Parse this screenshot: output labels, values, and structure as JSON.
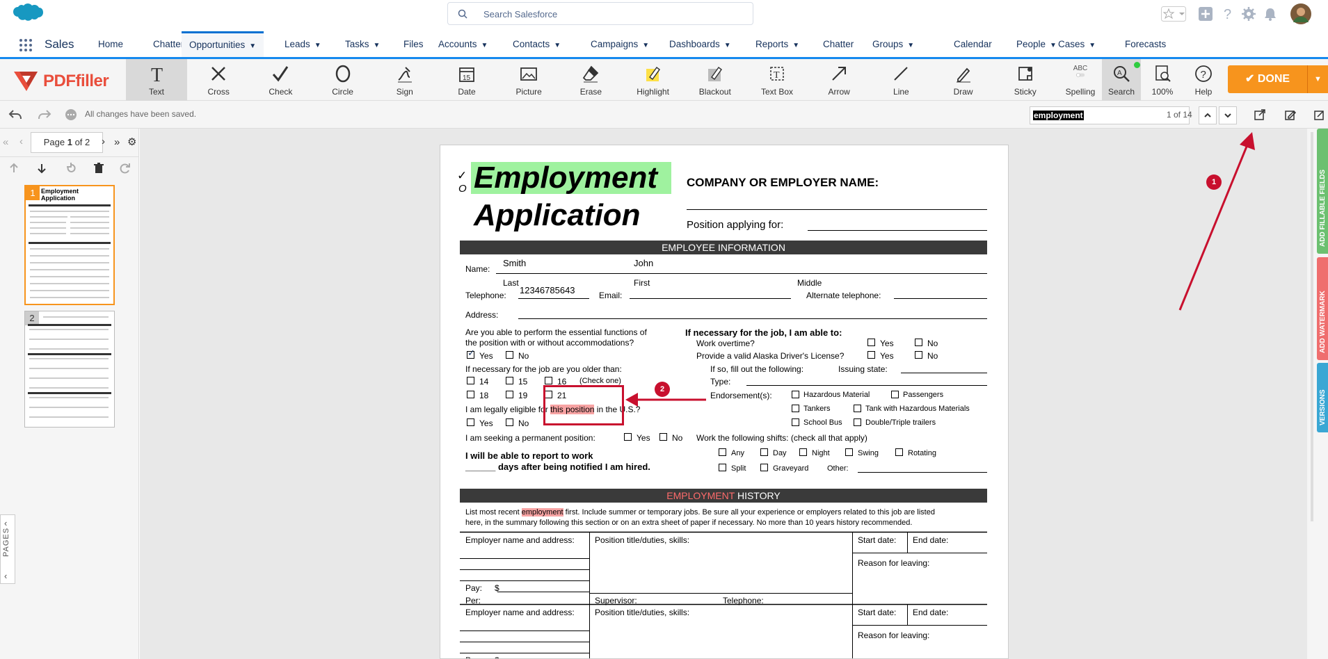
{
  "header": {
    "search_placeholder": "Search Salesforce",
    "app_name": "Sales"
  },
  "nav": {
    "items": [
      {
        "label": "Home",
        "chev": false
      },
      {
        "label": "Chatter",
        "chev": false
      },
      {
        "label": "Opportunities",
        "chev": true,
        "active": true
      },
      {
        "label": "Leads",
        "chev": true
      },
      {
        "label": "Tasks",
        "chev": true
      },
      {
        "label": "Files",
        "chev": false
      },
      {
        "label": "Accounts",
        "chev": true
      },
      {
        "label": "Contacts",
        "chev": true
      },
      {
        "label": "Campaigns",
        "chev": true
      },
      {
        "label": "Dashboards",
        "chev": true
      },
      {
        "label": "Reports",
        "chev": true
      },
      {
        "label": "Chatter",
        "chev": false
      },
      {
        "label": "Groups",
        "chev": true
      },
      {
        "label": "Calendar",
        "chev": false
      },
      {
        "label": "People",
        "chev": true
      },
      {
        "label": "Cases",
        "chev": true
      },
      {
        "label": "Forecasts",
        "chev": false
      }
    ]
  },
  "toolbar": {
    "logo": "PDFfiller",
    "tools": [
      "Text",
      "Cross",
      "Check",
      "Circle",
      "Sign",
      "Date",
      "Picture",
      "Erase",
      "Highlight",
      "Blackout",
      "Text Box",
      "Arrow",
      "Line",
      "Draw",
      "Sticky"
    ],
    "spelling": "Spelling",
    "spelling_top": "ABC",
    "search": "Search",
    "zoom": "100%",
    "help": "Help",
    "done": "DONE"
  },
  "subbar": {
    "saved": "All changes have been saved.",
    "find_value": "employment",
    "find_count": "1 of 14"
  },
  "pager": {
    "label_prefix": "Page ",
    "current": "1",
    "of": " of 2"
  },
  "thumbs": {
    "p1": "1",
    "p2": "2",
    "p1_title1": "Employment",
    "p1_title2": "Application"
  },
  "pages_tab": "PAGES",
  "side_tabs": {
    "fields": "ADD FILLABLE FIELDS",
    "watermark": "ADD WATERMARK",
    "versions": "VERSIONS"
  },
  "callouts": {
    "one": "1",
    "two": "2"
  },
  "form": {
    "title1": "Employment",
    "title2": "Application",
    "company": "COMPANY OR EMPLOYER NAME:",
    "position_for": "Position applying for:",
    "sec_employee": "EMPLOYEE INFORMATION",
    "name_lbl": "Name:",
    "last_val": "Smith",
    "first_val": "John",
    "last": "Last",
    "first": "First",
    "middle": "Middle",
    "telephone": "Telephone:",
    "tel_val": "12346785643",
    "email": "Email:",
    "alt_tel": "Alternate telephone:",
    "address": "Address:",
    "q_essential1": "Are you able to perform the essential functions of",
    "q_essential2": "the position with or without accommodations?",
    "yes": "Yes",
    "no": "No",
    "q_older": "If necessary for the job are you older than:",
    "a14": "14",
    "a15": "15",
    "a16": "16",
    "check_one": "(Check one)",
    "a18": "18",
    "a19": "19",
    "a21": "21",
    "q_eligible_a": "I am legally eligible for ",
    "q_eligible_hl": "this position",
    "q_eligible_b": " in the U.S.?",
    "q_permanent": "I am seeking a permanent position:",
    "report1": "I will be able to report to work",
    "report2": "______ days after being notified I am hired.",
    "able_to": "If necessary for the job, I am able to:",
    "overtime": "Work overtime?",
    "license": "Provide a valid Alaska Driver's License?",
    "fill_out": "If so, fill out the following:",
    "issuing": "Issuing state:",
    "type": "Type:",
    "endorse": "Endorsement(s):",
    "hazmat": "Hazardous Material",
    "passengers": "Passengers",
    "tankers": "Tankers",
    "tank_haz": "Tank with Hazardous Materials",
    "school": "School Bus",
    "double": "Double/Triple trailers",
    "shifts": "Work the following shifts: (check all that apply)",
    "any": "Any",
    "day": "Day",
    "night": "Night",
    "swing": "Swing",
    "rotating": "Rotating",
    "split": "Split",
    "graveyard": "Graveyard",
    "other": "Other:",
    "sec_history_hl": "EMPLOYMENT",
    "sec_history_b": " HISTORY",
    "list1_a": "List most recent ",
    "list1_hl": "employment",
    "list1_b": " first. Include summer or temporary jobs. Be sure all your experience or employers related to this job are listed",
    "list2": "here, in the summary following this section or on an extra sheet of paper if necessary. No more than 10 years history recommended.",
    "emp_name": "Employer name and address:",
    "pos_title": "Position title/duties, skills:",
    "start": "Start date:",
    "end": "End date:",
    "reason": "Reason for leaving:",
    "pay": "Pay:",
    "dollar": "$",
    "per": "Per:",
    "supervisor": "Supervisor:",
    "telephone2": "Telephone:"
  }
}
